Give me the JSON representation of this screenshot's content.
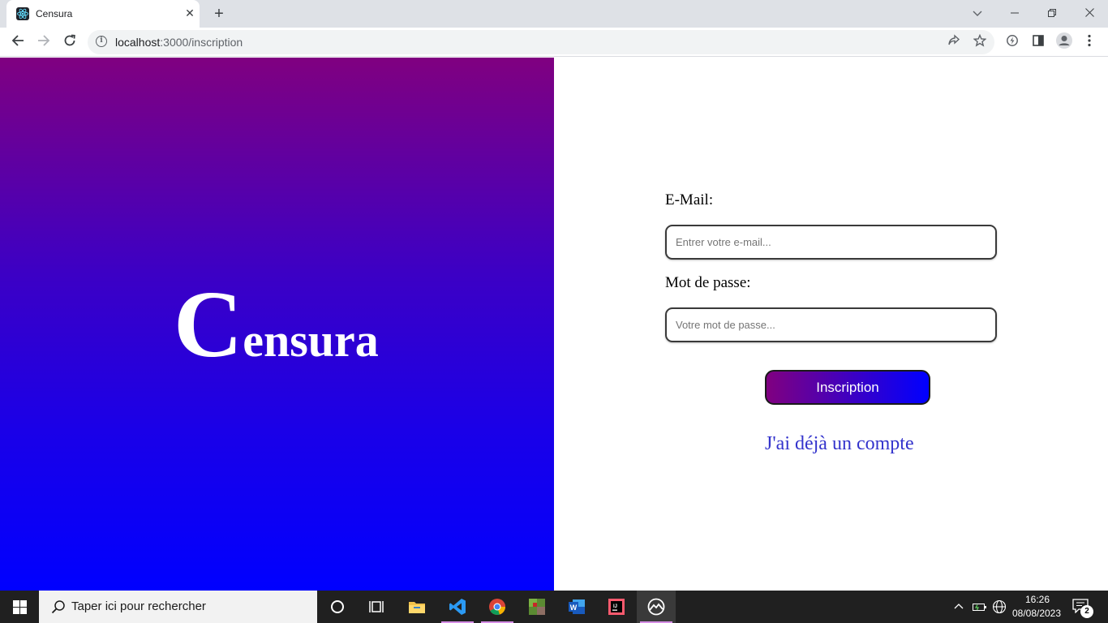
{
  "browser": {
    "tab_title": "Censura",
    "tab_close": "✕",
    "new_tab": "+",
    "url_host": "localhost",
    "url_path": ":3000/inscription"
  },
  "hero": {
    "logo_initial": "C",
    "logo_rest": "ensura",
    "gradient_top": "#800080",
    "gradient_bottom": "#0000ff"
  },
  "form": {
    "email_label": "E-Mail:",
    "email_placeholder": "Entrer votre e-mail...",
    "email_value": "",
    "password_label": "Mot de passe:",
    "password_placeholder": "Votre mot de passe...",
    "password_value": "",
    "submit_label": "Inscription",
    "login_link": "J'ai déjà un compte"
  },
  "taskbar": {
    "search_placeholder": "Taper ici pour rechercher",
    "time": "16:26",
    "date": "08/08/2023",
    "notification_count": "2"
  },
  "icons": {
    "tab_favicon": "react-icon",
    "back": "back-arrow-icon",
    "forward": "forward-arrow-icon",
    "reload": "reload-icon",
    "site_info": "info-icon",
    "share": "share-icon",
    "bookmark": "star-icon",
    "extension": "extension-icon",
    "side_panel": "side-panel-icon",
    "profile": "profile-icon",
    "menu": "kebab-menu-icon"
  }
}
